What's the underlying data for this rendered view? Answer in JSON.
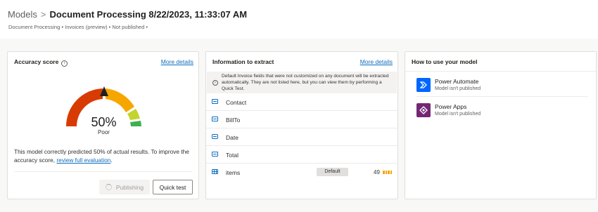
{
  "header": {
    "breadcrumb_root": "Models",
    "breadcrumb_separator": ">",
    "title": "Document Processing 8/22/2023, 11:33:07 AM",
    "subtitle": "Document Processing • Invoices (preview) • Not published •"
  },
  "accuracy": {
    "title": "Accuracy score",
    "more_details": "More details",
    "score": "50%",
    "score_value": 0.5,
    "rating": "Poor",
    "description": "This model correctly predicted 50% of actual results. To improve the accuracy score, ",
    "review_link": "review full evaluation",
    "description_end": ".",
    "publishing_label": "Publishing",
    "quick_test_label": "Quick test",
    "gauge_colors": [
      "#d83b01",
      "#f7a600",
      "#c4d42e",
      "#3fb04f"
    ]
  },
  "extract": {
    "title": "Information to extract",
    "more_details": "More details",
    "notice": "Default Invoice fields that were not customized on any document will be extracted automatically. They are not listed here, but you can view them by performing a Quick Test.",
    "fields": [
      {
        "name": "Contact",
        "icon": "text-field-icon"
      },
      {
        "name": "BillTo",
        "icon": "text-field-icon"
      },
      {
        "name": "Date",
        "icon": "date-field-icon"
      },
      {
        "name": "Total",
        "icon": "text-field-icon"
      },
      {
        "name": "items",
        "icon": "table-field-icon",
        "badge": "Default",
        "count": "49"
      }
    ]
  },
  "usage": {
    "title": "How to use your model",
    "apps": [
      {
        "name": "Power Automate",
        "status": "Model isn't published",
        "color": "#0066ff"
      },
      {
        "name": "Power Apps",
        "status": "Model isn't published",
        "color": "#742774"
      }
    ]
  }
}
